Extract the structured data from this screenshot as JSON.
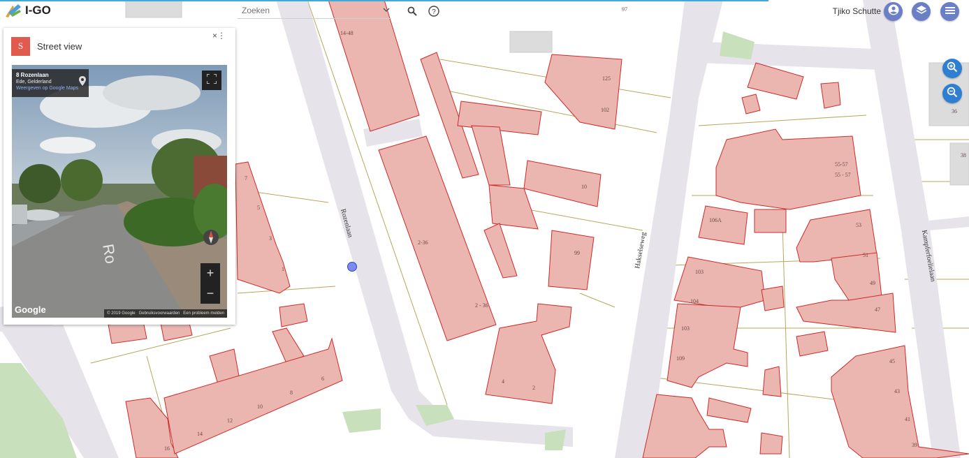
{
  "app": {
    "logo_text": "I-GO"
  },
  "header": {
    "search_placeholder": "Zoeken",
    "search_value": "Zoeken",
    "user_name": "Tjiko Schutte"
  },
  "panel": {
    "badge": "S",
    "title": "Street view",
    "close_symbol": "×",
    "more_symbol": "⋮",
    "streetview": {
      "address": "8 Rozenlaan",
      "city": "Ede, Gelderland",
      "link_text": "Weergeven op Google Maps",
      "logo": "Google",
      "copyright": "© 2019 Google",
      "terms": "Gebruiksvoorwaarden",
      "report": "Een probleem melden",
      "zoom_in": "+",
      "zoom_out": "−",
      "street_sign": "Ro"
    }
  },
  "map": {
    "streets": [
      "Rozenlaan",
      "Hakselseweg",
      "Kampferfoelielaan"
    ],
    "house_numbers": [
      "14-48",
      "2-36",
      "2 - 36",
      "125",
      "102",
      "10",
      "99",
      "55-57",
      "55 - 57",
      "106A",
      "53",
      "51",
      "49",
      "47",
      "103",
      "104",
      "109",
      "45",
      "43",
      "41",
      "39",
      "2",
      "4",
      "7",
      "5",
      "3",
      "1",
      "6",
      "8",
      "10",
      "12",
      "14",
      "16",
      "36",
      "38",
      "97"
    ]
  },
  "icons": {
    "search": "search-icon",
    "help": "help-icon",
    "account": "account-icon",
    "layers": "layers-icon",
    "menu": "menu-icon",
    "zoom_in": "zoom-in-icon",
    "zoom_out": "zoom-out-icon"
  },
  "colors": {
    "accent": "#6b7fc7",
    "zoom": "#2e7fd1",
    "parcel_fill": "#ebb6b0",
    "parcel_stroke": "#cc2a2a",
    "street": "#e3e0e6"
  }
}
